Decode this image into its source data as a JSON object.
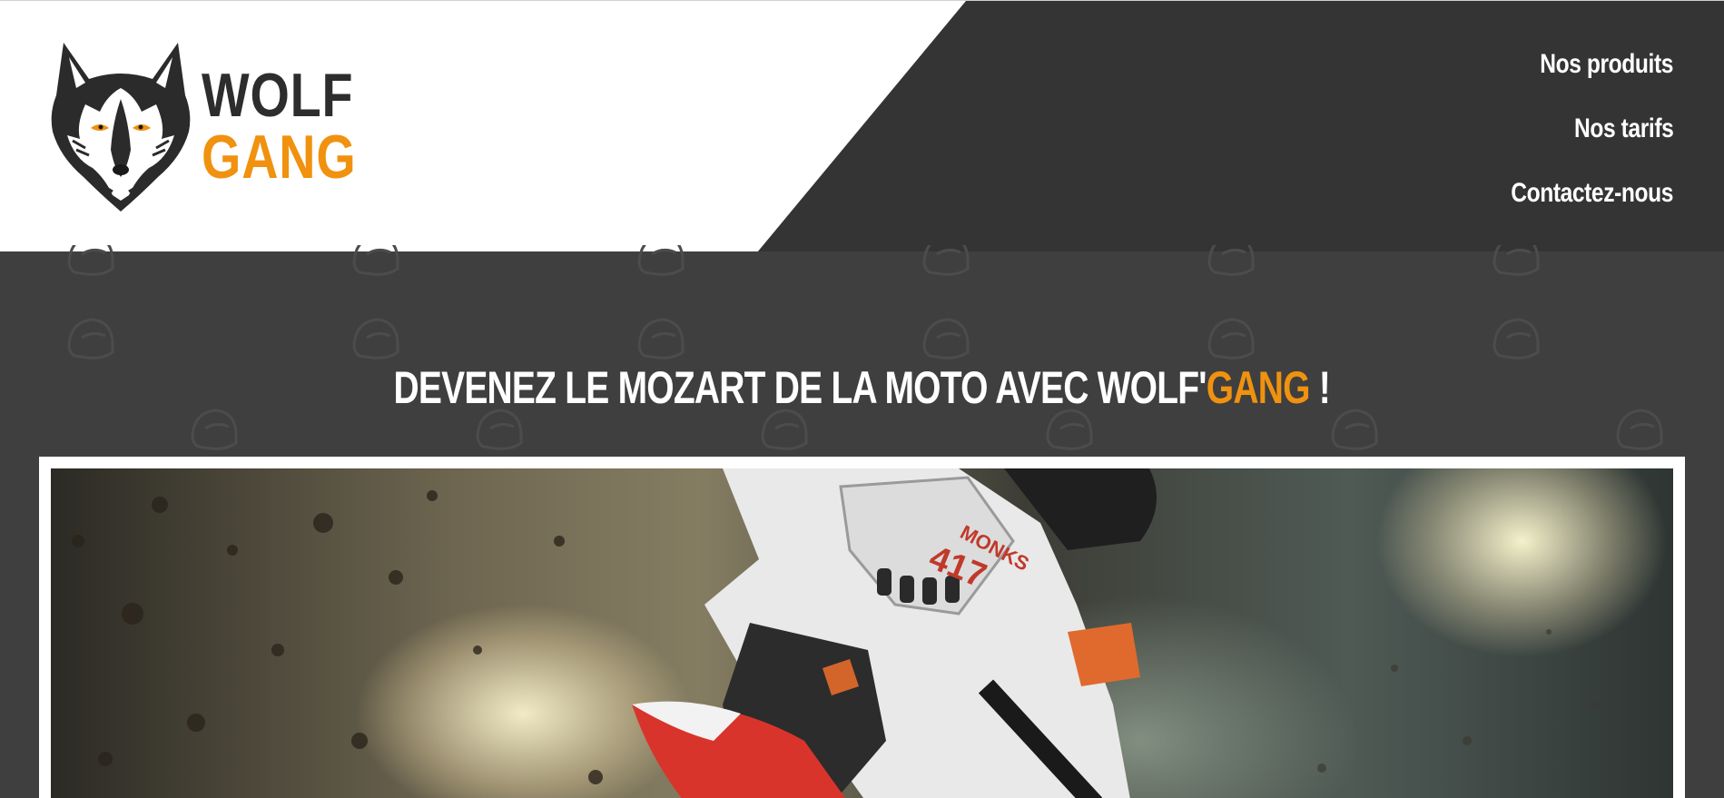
{
  "brand": {
    "line1": "WOLF",
    "line2": "GANG",
    "logo_icon": "wolf-head-icon",
    "accent_color": "#f0920f"
  },
  "nav": {
    "items": [
      {
        "label": "Nos produits"
      },
      {
        "label": "Nos tarifs"
      },
      {
        "label": "Contactez-nous"
      }
    ]
  },
  "hero": {
    "headline_start": "DEVENEZ LE MOZART DE LA MOTO AVEC WOLF'",
    "headline_accent": "GANG",
    "headline_end": " !",
    "background_pattern_icon": "helmet-icon",
    "image": {
      "subject": "motocross-rider-photo",
      "rider_number": "417",
      "rider_name": "MONKS"
    }
  },
  "colors": {
    "header_dark": "#343434",
    "hero_background": "#3f3f3f",
    "accent": "#f0920f"
  }
}
